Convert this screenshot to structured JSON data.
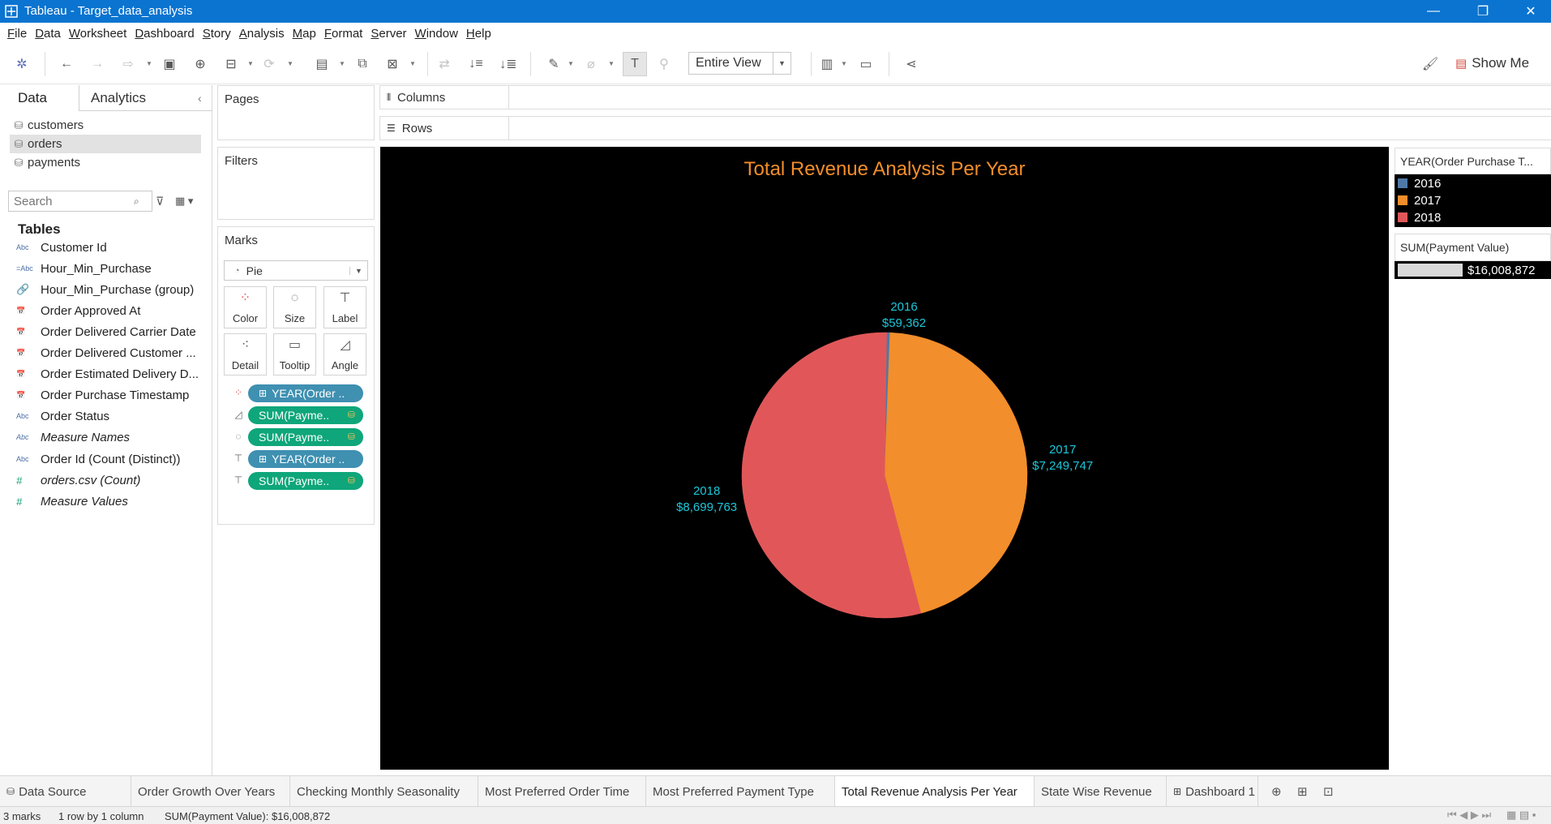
{
  "window": {
    "title": "Tableau - Target_data_analysis",
    "minimize": "—",
    "maximize": "❐",
    "close": "✕"
  },
  "menu": [
    "File",
    "Data",
    "Worksheet",
    "Dashboard",
    "Story",
    "Analysis",
    "Map",
    "Format",
    "Server",
    "Window",
    "Help"
  ],
  "toolbar": {
    "view_mode": "Entire View",
    "show_me": "Show Me"
  },
  "data_pane": {
    "tabs": [
      "Data",
      "Analytics"
    ],
    "datasources": [
      "customers",
      "orders",
      "payments"
    ],
    "selected_datasource": "orders",
    "search_placeholder": "Search",
    "tables_heading": "Tables",
    "fields": [
      {
        "icon": "Abc",
        "name": "Customer Id",
        "italic": false
      },
      {
        "icon": "=Abc",
        "name": "Hour_Min_Purchase",
        "italic": false
      },
      {
        "icon": "🔗",
        "name": "Hour_Min_Purchase (group)",
        "italic": false
      },
      {
        "icon": "📅",
        "name": "Order Approved At",
        "italic": false
      },
      {
        "icon": "📅",
        "name": "Order Delivered Carrier Date",
        "italic": false
      },
      {
        "icon": "📅",
        "name": "Order Delivered Customer ...",
        "italic": false
      },
      {
        "icon": "📅",
        "name": "Order Estimated Delivery D...",
        "italic": false
      },
      {
        "icon": "📅",
        "name": "Order Purchase Timestamp",
        "italic": false
      },
      {
        "icon": "Abc",
        "name": "Order Status",
        "italic": false
      },
      {
        "icon": "Abc",
        "name": "Measure Names",
        "italic": true
      },
      {
        "icon": "Abc",
        "name": "Order Id (Count (Distinct))",
        "italic": false
      },
      {
        "icon": "#",
        "name": "orders.csv (Count)",
        "italic": true
      },
      {
        "icon": "#",
        "name": "Measure Values",
        "italic": true
      }
    ]
  },
  "cards": {
    "pages": "Pages",
    "filters": "Filters",
    "marks": "Marks",
    "columns": "Columns",
    "rows": "Rows"
  },
  "marks": {
    "type": "Pie",
    "buttons": [
      "Color",
      "Size",
      "Label",
      "Detail",
      "Tooltip",
      "Angle"
    ],
    "pills": [
      {
        "icon": "color",
        "text": "YEAR(Order ..",
        "kind": "blue",
        "plus": true,
        "warn": false
      },
      {
        "icon": "angle",
        "text": "SUM(Payme..",
        "kind": "green",
        "plus": false,
        "warn": true
      },
      {
        "icon": "size",
        "text": "SUM(Payme..",
        "kind": "green",
        "plus": false,
        "warn": true
      },
      {
        "icon": "label",
        "text": "YEAR(Order ..",
        "kind": "blue",
        "plus": true,
        "warn": false
      },
      {
        "icon": "label",
        "text": "SUM(Payme..",
        "kind": "green",
        "plus": false,
        "warn": true
      }
    ]
  },
  "viz": {
    "title": "Total Revenue Analysis Per Year",
    "label_color": "#1cc7d9",
    "background": "#000000"
  },
  "chart_data": {
    "type": "pie",
    "title": "Total Revenue Analysis Per Year",
    "categories": [
      "2016",
      "2017",
      "2018"
    ],
    "values": [
      59362,
      7249747,
      8699763
    ],
    "labels": [
      "$59,362",
      "$7,249,747",
      "$8,699,763"
    ],
    "colors": [
      "#4e79a7",
      "#f28e2b",
      "#e15759"
    ]
  },
  "legends": {
    "color_title": "YEAR(Order Purchase T...",
    "color_items": [
      {
        "label": "2016",
        "color": "#4e79a7"
      },
      {
        "label": "2017",
        "color": "#f28e2b"
      },
      {
        "label": "2018",
        "color": "#e15759"
      }
    ],
    "size_title": "SUM(Payment Value)",
    "size_value": "$16,008,872"
  },
  "sheet_tabs": [
    "Data Source",
    "Order Growth Over Years",
    "Checking Monthly Seasonality",
    "Most Preferred Order Time",
    "Most Preferred Payment Type",
    "Total Revenue Analysis Per Year",
    "State Wise Revenue",
    "Dashboard 1"
  ],
  "active_sheet": "Total Revenue Analysis Per Year",
  "status": {
    "marks": "3 marks",
    "dims": "1 row by 1 column",
    "sum": "SUM(Payment Value): $16,008,872"
  }
}
